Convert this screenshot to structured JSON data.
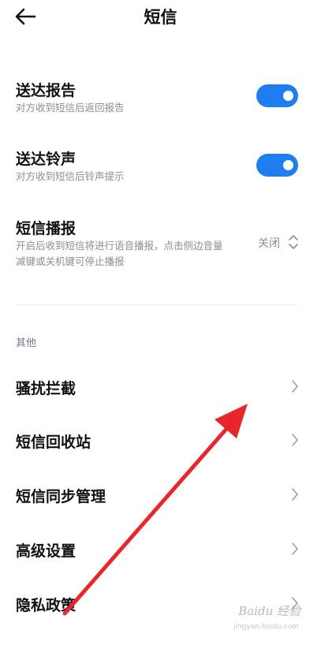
{
  "header": {
    "title": "短信",
    "back_icon": "arrow-left-icon"
  },
  "settings": [
    {
      "title": "送达报告",
      "subtitle": "对方收到短信后返回报告",
      "toggle_on": true
    },
    {
      "title": "送达铃声",
      "subtitle": "对方收到短信后铃声提示",
      "toggle_on": true
    }
  ],
  "broadcast": {
    "title": "短信播报",
    "subtitle_line1": "开启后收到短信将进行语音播报，点击侧边音量",
    "subtitle_line2": "减键或关机键可停止播报",
    "value": "关闭"
  },
  "section_label": "其他",
  "nav_items": [
    {
      "label": "骚扰拦截"
    },
    {
      "label": "短信回收站"
    },
    {
      "label": "短信同步管理"
    },
    {
      "label": "高级设置"
    },
    {
      "label": "隐私政策"
    }
  ],
  "watermark": {
    "text": "Baidu 经验",
    "sub": "jingyan.baidu.com"
  },
  "colors": {
    "accent": "#1f7df2",
    "annotation_arrow": "#e8272c"
  }
}
